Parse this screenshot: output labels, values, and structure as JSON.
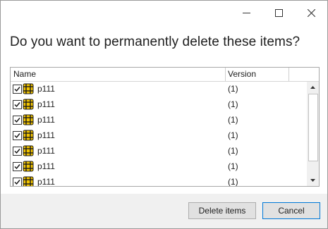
{
  "window": {
    "controls": {
      "minimize_icon": "minimize-icon",
      "maximize_icon": "maximize-icon",
      "close_icon": "close-icon"
    }
  },
  "dialog": {
    "question": "Do you want to permanently delete these items?"
  },
  "grid": {
    "columns": [
      {
        "label": "Name"
      },
      {
        "label": "Version"
      },
      {
        "label": ""
      }
    ],
    "rows": [
      {
        "checked": true,
        "icon": "part-icon",
        "name": "p111",
        "version": "(1)"
      },
      {
        "checked": true,
        "icon": "part-icon",
        "name": "p111",
        "version": "(1)"
      },
      {
        "checked": true,
        "icon": "part-icon",
        "name": "p111",
        "version": "(1)"
      },
      {
        "checked": true,
        "icon": "part-icon",
        "name": "p111",
        "version": "(1)"
      },
      {
        "checked": true,
        "icon": "part-icon",
        "name": "p111",
        "version": "(1)"
      },
      {
        "checked": true,
        "icon": "part-icon",
        "name": "p111",
        "version": "(1)"
      },
      {
        "checked": true,
        "icon": "part-icon",
        "name": "p111",
        "version": "(1)"
      }
    ]
  },
  "buttons": {
    "delete_label": "Delete items",
    "cancel_label": "Cancel"
  },
  "colors": {
    "icon_yellow": "#f2c400",
    "icon_dark": "#1a1a1a",
    "focus_border": "#0078d7",
    "footer_bg": "#f0f0f0"
  }
}
